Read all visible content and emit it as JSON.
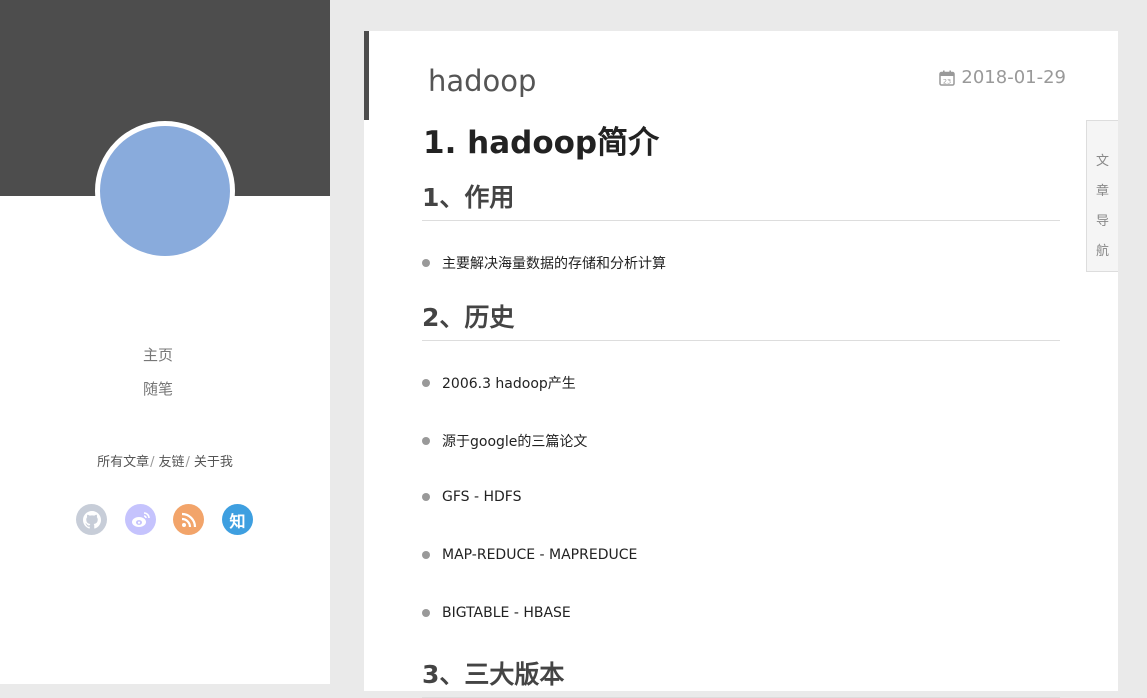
{
  "sidebar": {
    "nav": [
      {
        "label": "主页"
      },
      {
        "label": "随笔"
      }
    ],
    "links": [
      {
        "label": "所有文章"
      },
      {
        "label": "友链"
      },
      {
        "label": "关于我"
      }
    ],
    "link_separator": "/",
    "socials": [
      {
        "icon": "github-icon",
        "color": "#c7cdd8"
      },
      {
        "icon": "weibo-icon",
        "color": "#c5c3fd"
      },
      {
        "icon": "rss-icon",
        "color": "#f2a46a"
      },
      {
        "icon": "zhihu-icon",
        "color": "#3e9fe0",
        "glyph": "知"
      }
    ]
  },
  "post": {
    "title": "hadoop",
    "date": "2018-01-29",
    "calendar_day": "23",
    "h1": "1. hadoop简介",
    "sections": [
      {
        "heading": "1、作用",
        "items": [
          "主要解决海量数据的存储和分析计算"
        ]
      },
      {
        "heading": "2、历史",
        "items": [
          "2006.3 hadoop产生",
          "源于google的三篇论文",
          "GFS - HDFS",
          "MAP-REDUCE - MAPREDUCE",
          "BIGTABLE - HBASE"
        ]
      },
      {
        "heading": "3、三大版本",
        "items": []
      }
    ]
  },
  "toc": {
    "chars": [
      "文",
      "章",
      "导",
      "航"
    ]
  }
}
